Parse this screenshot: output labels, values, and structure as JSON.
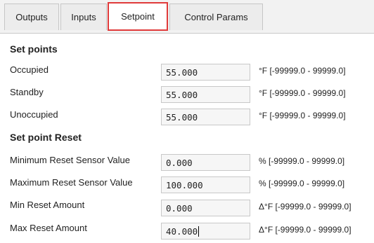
{
  "tabs": [
    {
      "label": "Outputs"
    },
    {
      "label": "Inputs"
    },
    {
      "label": "Setpoint",
      "active": true
    },
    {
      "label": "Control Params"
    }
  ],
  "sections": {
    "setpoints_title": "Set points",
    "reset_title": "Set point Reset"
  },
  "setpoints": [
    {
      "label": "Occupied",
      "value": "55.000",
      "range": "°F [-99999.0 - 99999.0]"
    },
    {
      "label": "Standby",
      "value": "55.000",
      "range": "°F [-99999.0 - 99999.0]"
    },
    {
      "label": "Unoccupied",
      "value": "55.000",
      "range": "°F [-99999.0 - 99999.0]"
    }
  ],
  "reset": [
    {
      "label": "Minimum Reset Sensor Value",
      "value": "0.000",
      "range": "% [-99999.0 - 99999.0]"
    },
    {
      "label": "Maximum Reset Sensor Value",
      "value": "100.000",
      "range": "% [-99999.0 - 99999.0]"
    },
    {
      "label": "Min Reset Amount",
      "value": "0.000",
      "range": "Δ°F [-99999.0 - 99999.0]"
    },
    {
      "label": "Max Reset Amount",
      "value": "40.000",
      "range": "Δ°F [-99999.0 - 99999.0]"
    }
  ],
  "colors": {
    "active_tab_border": "#e03a3a",
    "tab_bg": "#ececec",
    "field_bg": "#f6f6f6"
  }
}
